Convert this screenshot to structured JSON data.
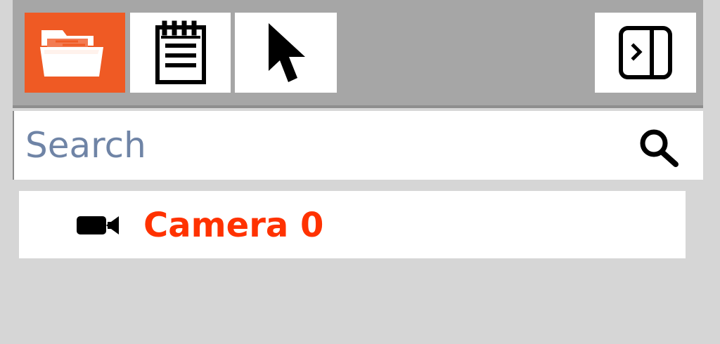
{
  "toolbar": {
    "buttons": [
      {
        "icon": "folder-open-icon",
        "active": true
      },
      {
        "icon": "clipboard-notes-icon",
        "active": false
      },
      {
        "icon": "pointer-icon",
        "active": false
      },
      {
        "icon": "collapse-panel-icon",
        "active": false
      }
    ]
  },
  "search": {
    "placeholder": "Search",
    "value": "",
    "icon": "search-icon"
  },
  "tree": {
    "items": [
      {
        "label": "Camera 0",
        "icon": "camera-icon",
        "label_color": "#ff3200"
      }
    ]
  },
  "colors": {
    "accent": "#ef5a24",
    "toolbar_background": "#a6a6a6",
    "panel_background": "#d6d6d6",
    "selected_label": "#ff3200",
    "search_placeholder": "#6f84a6"
  }
}
